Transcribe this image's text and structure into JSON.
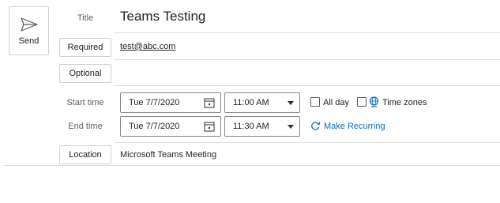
{
  "send": {
    "label": "Send",
    "icon": "send-icon"
  },
  "title": {
    "label": "Title",
    "value": "Teams Testing"
  },
  "required": {
    "label": "Required",
    "value": "test@abc.com"
  },
  "optional": {
    "label": "Optional",
    "value": ""
  },
  "start": {
    "label": "Start time",
    "date": "Tue 7/7/2020",
    "time": "11:00 AM"
  },
  "end": {
    "label": "End time",
    "date": "Tue 7/7/2020",
    "time": "11:30 AM"
  },
  "options": {
    "all_day": "All day",
    "time_zones": "Time zones",
    "make_recurring": "Make Recurring"
  },
  "location": {
    "label": "Location",
    "value": "Microsoft Teams Meeting"
  },
  "colors": {
    "accent": "#0f6cbd",
    "border": "#8a8886",
    "rule": "#e1dfdd"
  }
}
